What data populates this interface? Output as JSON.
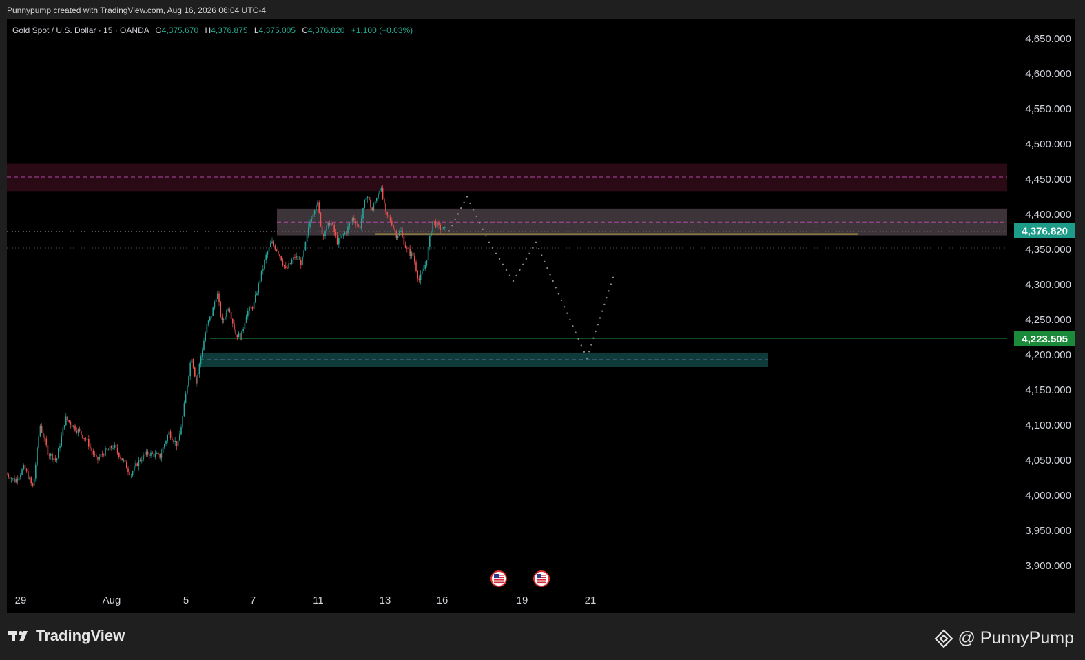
{
  "header": {
    "attribution": "Punnypump created with TradingView.com, Aug 16, 2026 06:04 UTC-4"
  },
  "legend": {
    "symbol": "Gold Spot / U.S. Dollar · 15 · OANDA",
    "open_label": "O",
    "open": "4,375.670",
    "high_label": "H",
    "high": "4,376.875",
    "low_label": "L",
    "low": "4,375.005",
    "close_label": "C",
    "close": "4,376.820",
    "change": "+1.100 (+0.03%)"
  },
  "footer": {
    "logo_text": "TradingView",
    "brand_text": "@ PunnyPump"
  },
  "colors": {
    "background": "#000000",
    "up": "#26a69a",
    "down": "#ef5350",
    "price_label": "#1e9c8a",
    "level_label": "#1b8a3a",
    "yellow_line": "#f5e342",
    "supply_zone": "#2a0a14",
    "mid_zone": "#3d3439",
    "demand_zone": "#0f3a3a"
  },
  "chart_data": {
    "type": "candlestick",
    "ylim": [
      3860,
      4680
    ],
    "y_ticks": [
      3900,
      3950,
      4000,
      4050,
      4100,
      4150,
      4200,
      4250,
      4300,
      4350,
      4400,
      4450,
      4500,
      4550,
      4600,
      4650
    ],
    "y_tick_labels": [
      "3,900.000",
      "3,950.000",
      "4,000.000",
      "4,050.000",
      "4,100.000",
      "4,150.000",
      "4,200.000",
      "4,250.000",
      "4,300.000",
      "4,350.000",
      "4,400.000",
      "4,450.000",
      "4,500.000",
      "4,550.000",
      "4,600.000",
      "4,650.000"
    ],
    "x_tick_labels": [
      "29",
      "Aug",
      "5",
      "7",
      "11",
      "13",
      "16",
      "19",
      "21"
    ],
    "current_price_label": "4,376.820",
    "current_price": 4376.82,
    "level_label": "4,223.505",
    "level_price": 4223.505,
    "price_path": [
      [
        0,
        4030
      ],
      [
        12,
        4020
      ],
      [
        25,
        4040
      ],
      [
        38,
        4010
      ],
      [
        48,
        4100
      ],
      [
        60,
        4060
      ],
      [
        72,
        4050
      ],
      [
        85,
        4110
      ],
      [
        100,
        4095
      ],
      [
        115,
        4080
      ],
      [
        130,
        4050
      ],
      [
        140,
        4060
      ],
      [
        155,
        4070
      ],
      [
        165,
        4055
      ],
      [
        180,
        4030
      ],
      [
        192,
        4050
      ],
      [
        205,
        4060
      ],
      [
        222,
        4055
      ],
      [
        235,
        4090
      ],
      [
        248,
        4070
      ],
      [
        255,
        4110
      ],
      [
        262,
        4160
      ],
      [
        268,
        4200
      ],
      [
        275,
        4160
      ],
      [
        282,
        4200
      ],
      [
        290,
        4240
      ],
      [
        298,
        4260
      ],
      [
        305,
        4290
      ],
      [
        312,
        4245
      ],
      [
        322,
        4270
      ],
      [
        332,
        4230
      ],
      [
        340,
        4225
      ],
      [
        348,
        4260
      ],
      [
        358,
        4270
      ],
      [
        368,
        4310
      ],
      [
        376,
        4340
      ],
      [
        384,
        4360
      ],
      [
        395,
        4345
      ],
      [
        405,
        4320
      ],
      [
        418,
        4340
      ],
      [
        428,
        4330
      ],
      [
        440,
        4390
      ],
      [
        450,
        4420
      ],
      [
        458,
        4370
      ],
      [
        470,
        4390
      ],
      [
        480,
        4360
      ],
      [
        492,
        4375
      ],
      [
        502,
        4395
      ],
      [
        512,
        4380
      ],
      [
        522,
        4430
      ],
      [
        530,
        4405
      ],
      [
        542,
        4440
      ],
      [
        550,
        4400
      ],
      [
        558,
        4390
      ],
      [
        565,
        4370
      ],
      [
        572,
        4375
      ],
      [
        580,
        4350
      ],
      [
        590,
        4340
      ],
      [
        598,
        4305
      ],
      [
        608,
        4330
      ],
      [
        618,
        4390
      ],
      [
        628,
        4380
      ],
      [
        638,
        4376.8
      ]
    ],
    "projection_path": [
      [
        642,
        4376
      ],
      [
        668,
        4425
      ],
      [
        700,
        4360
      ],
      [
        735,
        4305
      ],
      [
        768,
        4360
      ],
      [
        842,
        4195
      ],
      [
        880,
        4310
      ],
      [
        888,
        4300
      ]
    ],
    "zones": [
      {
        "name": "supply-zone",
        "from": 4433,
        "to": 4472,
        "mid": 4453
      },
      {
        "name": "mid-zone",
        "from": 4370,
        "to": 4408,
        "mid": 4389
      },
      {
        "name": "demand-zone",
        "from": 4183,
        "to": 4203,
        "mid": 4193
      }
    ],
    "yellow_level": 4372,
    "dotted_levels": [
      4375,
      4352
    ],
    "news_markers": [
      "US",
      "US"
    ]
  }
}
